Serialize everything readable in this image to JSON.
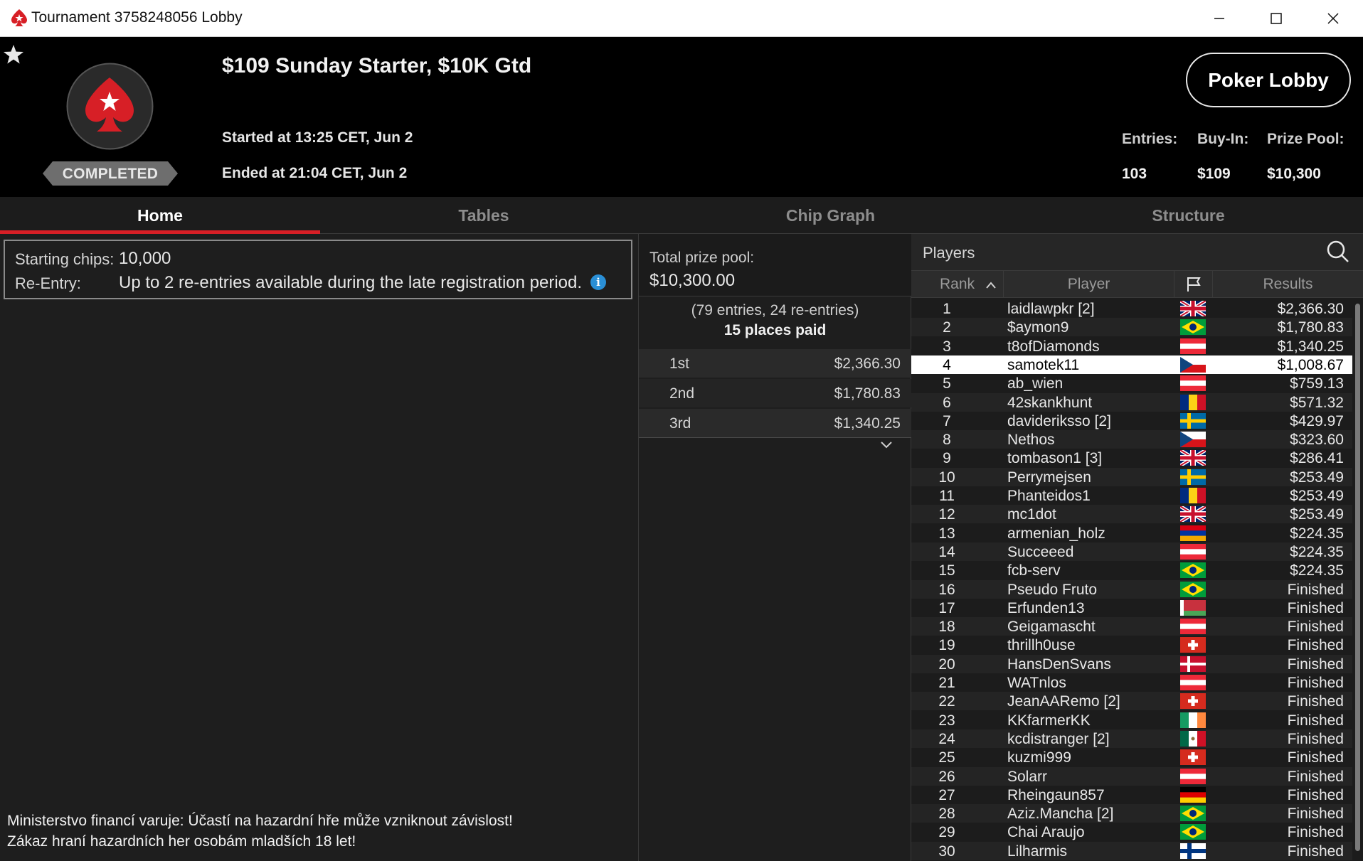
{
  "window": {
    "title": "Tournament 3758248056 Lobby"
  },
  "header": {
    "tournament_name": "$109 Sunday Starter, $10K Gtd",
    "started": "Started at 13:25 CET, Jun 2",
    "ended": "Ended at 21:04 CET, Jun 2",
    "status_badge": "COMPLETED",
    "lobby_button": "Poker Lobby",
    "entries_label": "Entries:",
    "entries_value": "103",
    "buyin_label": "Buy-In:",
    "buyin_value": "$109",
    "prizepool_label": "Prize Pool:",
    "prizepool_value": "$10,300"
  },
  "tabs": [
    {
      "label": "Home"
    },
    {
      "label": "Tables"
    },
    {
      "label": "Chip Graph"
    },
    {
      "label": "Structure"
    }
  ],
  "home": {
    "starting_chips_label": "Starting chips:",
    "starting_chips_value": "10,000",
    "reentry_label": "Re-Entry:",
    "reentry_value": "Up to 2 re-entries available during the late registration period.",
    "info_glyph": "i",
    "warning_line1": "Ministerstvo financí varuje: Účastí na hazardní hře může vzniknout závislost!",
    "warning_line2": "Zákaz hraní hazardních her osobám mladších 18 let!"
  },
  "prizes": {
    "total_label": "Total prize pool:",
    "total_value": "$10,300.00",
    "entries_text": "(79 entries, 24 re-entries)",
    "places_paid": "15 places paid",
    "list": [
      {
        "place": "1st",
        "amount": "$2,366.30"
      },
      {
        "place": "2nd",
        "amount": "$1,780.83"
      },
      {
        "place": "3rd",
        "amount": "$1,340.25"
      }
    ]
  },
  "players": {
    "title": "Players",
    "columns": {
      "rank": "Rank",
      "player": "Player",
      "results": "Results"
    },
    "sort": {
      "column": "rank",
      "direction": "ascending"
    },
    "highlighted_rank": 4,
    "rows": [
      {
        "rank": "1",
        "name": "laidlawpkr [2]",
        "flag": "gb",
        "result": "$2,366.30"
      },
      {
        "rank": "2",
        "name": "$aymon9",
        "flag": "br",
        "result": "$1,780.83"
      },
      {
        "rank": "3",
        "name": "t8ofDiamonds",
        "flag": "at",
        "result": "$1,340.25"
      },
      {
        "rank": "4",
        "name": "samotek11",
        "flag": "cz",
        "result": "$1,008.67"
      },
      {
        "rank": "5",
        "name": "ab_wien",
        "flag": "at",
        "result": "$759.13"
      },
      {
        "rank": "6",
        "name": "42skankhunt",
        "flag": "ro",
        "result": "$571.32"
      },
      {
        "rank": "7",
        "name": "davideriksso [2]",
        "flag": "se",
        "result": "$429.97"
      },
      {
        "rank": "8",
        "name": "Nethos",
        "flag": "cz",
        "result": "$323.60"
      },
      {
        "rank": "9",
        "name": "tombason1 [3]",
        "flag": "gb",
        "result": "$286.41"
      },
      {
        "rank": "10",
        "name": "Perrymejsen",
        "flag": "se",
        "result": "$253.49"
      },
      {
        "rank": "11",
        "name": "Phanteidos1",
        "flag": "ro",
        "result": "$253.49"
      },
      {
        "rank": "12",
        "name": "mc1dot",
        "flag": "gb",
        "result": "$253.49"
      },
      {
        "rank": "13",
        "name": "armenian_holz",
        "flag": "am",
        "result": "$224.35"
      },
      {
        "rank": "14",
        "name": "Succeeed",
        "flag": "at",
        "result": "$224.35"
      },
      {
        "rank": "15",
        "name": "fcb-serv",
        "flag": "br",
        "result": "$224.35"
      },
      {
        "rank": "16",
        "name": "Pseudo Fruto",
        "flag": "br",
        "result": "Finished"
      },
      {
        "rank": "17",
        "name": "Erfunden13",
        "flag": "by",
        "result": "Finished"
      },
      {
        "rank": "18",
        "name": "Geigamascht",
        "flag": "at",
        "result": "Finished"
      },
      {
        "rank": "19",
        "name": "thrillh0use",
        "flag": "ch",
        "result": "Finished"
      },
      {
        "rank": "20",
        "name": "HansDenSvans",
        "flag": "dk",
        "result": "Finished"
      },
      {
        "rank": "21",
        "name": "WATnlos",
        "flag": "at",
        "result": "Finished"
      },
      {
        "rank": "22",
        "name": "JeanAARemo [2]",
        "flag": "ch",
        "result": "Finished"
      },
      {
        "rank": "23",
        "name": "KKfarmerKK",
        "flag": "ie",
        "result": "Finished"
      },
      {
        "rank": "24",
        "name": "kcdistranger [2]",
        "flag": "mx",
        "result": "Finished"
      },
      {
        "rank": "25",
        "name": "kuzmi999",
        "flag": "ch",
        "result": "Finished"
      },
      {
        "rank": "26",
        "name": "Solarr",
        "flag": "at",
        "result": "Finished"
      },
      {
        "rank": "27",
        "name": "Rheingaun857",
        "flag": "de",
        "result": "Finished"
      },
      {
        "rank": "28",
        "name": "Aziz.Mancha [2]",
        "flag": "br",
        "result": "Finished"
      },
      {
        "rank": "29",
        "name": "Chai Araujo",
        "flag": "br",
        "result": "Finished"
      },
      {
        "rank": "30",
        "name": "Lilharmis",
        "flag": "fi",
        "result": "Finished"
      }
    ]
  },
  "colors": {
    "accent_red": "#d71f26",
    "info_blue": "#2a8fd6",
    "header_bg": "#000000",
    "panel_bg": "#1e1e1e"
  }
}
